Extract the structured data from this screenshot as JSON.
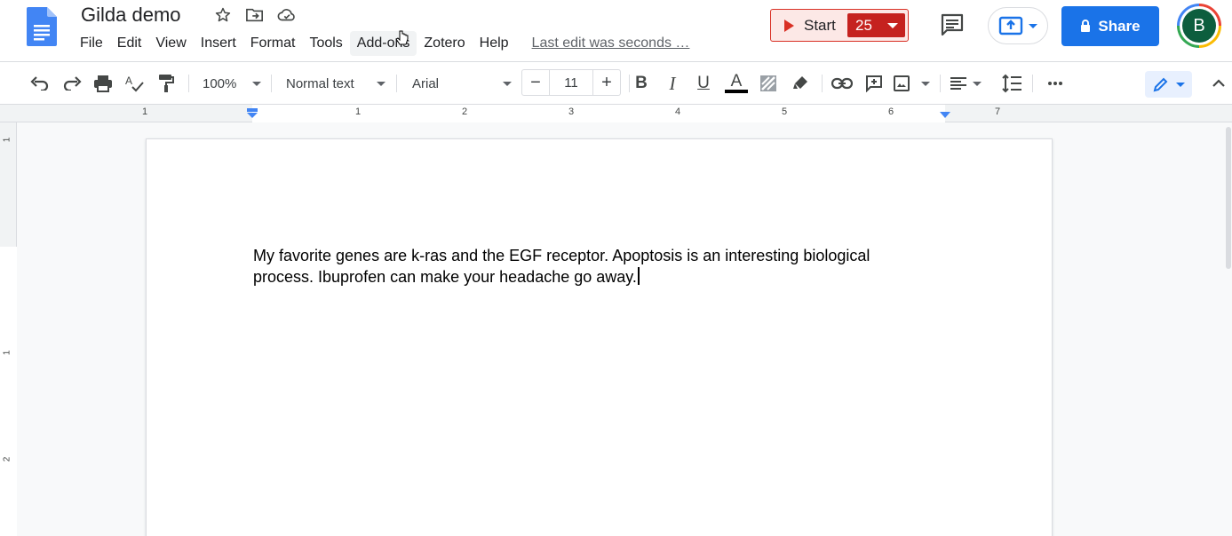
{
  "header": {
    "title": "Gilda demo",
    "menu": [
      "File",
      "Edit",
      "View",
      "Insert",
      "Format",
      "Tools",
      "Add-ons",
      "Zotero",
      "Help"
    ],
    "last_edit": "Last edit was seconds …",
    "start_label": "Start",
    "start_count": "25",
    "share_label": "Share",
    "avatar_initial": "B"
  },
  "toolbar": {
    "zoom": "100%",
    "style": "Normal text",
    "font": "Arial",
    "font_size": "11",
    "minus": "−",
    "plus": "+",
    "bold": "B",
    "italic": "I",
    "underline": "U",
    "text_color_letter": "A"
  },
  "ruler": {
    "labels": [
      "1",
      "1",
      "2",
      "3",
      "4",
      "5",
      "6",
      "7"
    ],
    "vertical_labels": [
      "1",
      "1",
      "2"
    ]
  },
  "document": {
    "text": "My favorite genes are k-ras and the EGF receptor. Apoptosis is an interesting biological process. Ibuprofen can make your headache go away."
  },
  "colors": {
    "accent": "#1a73e8",
    "start_red": "#d93025",
    "avatar_bg": "#0d5e3e"
  }
}
